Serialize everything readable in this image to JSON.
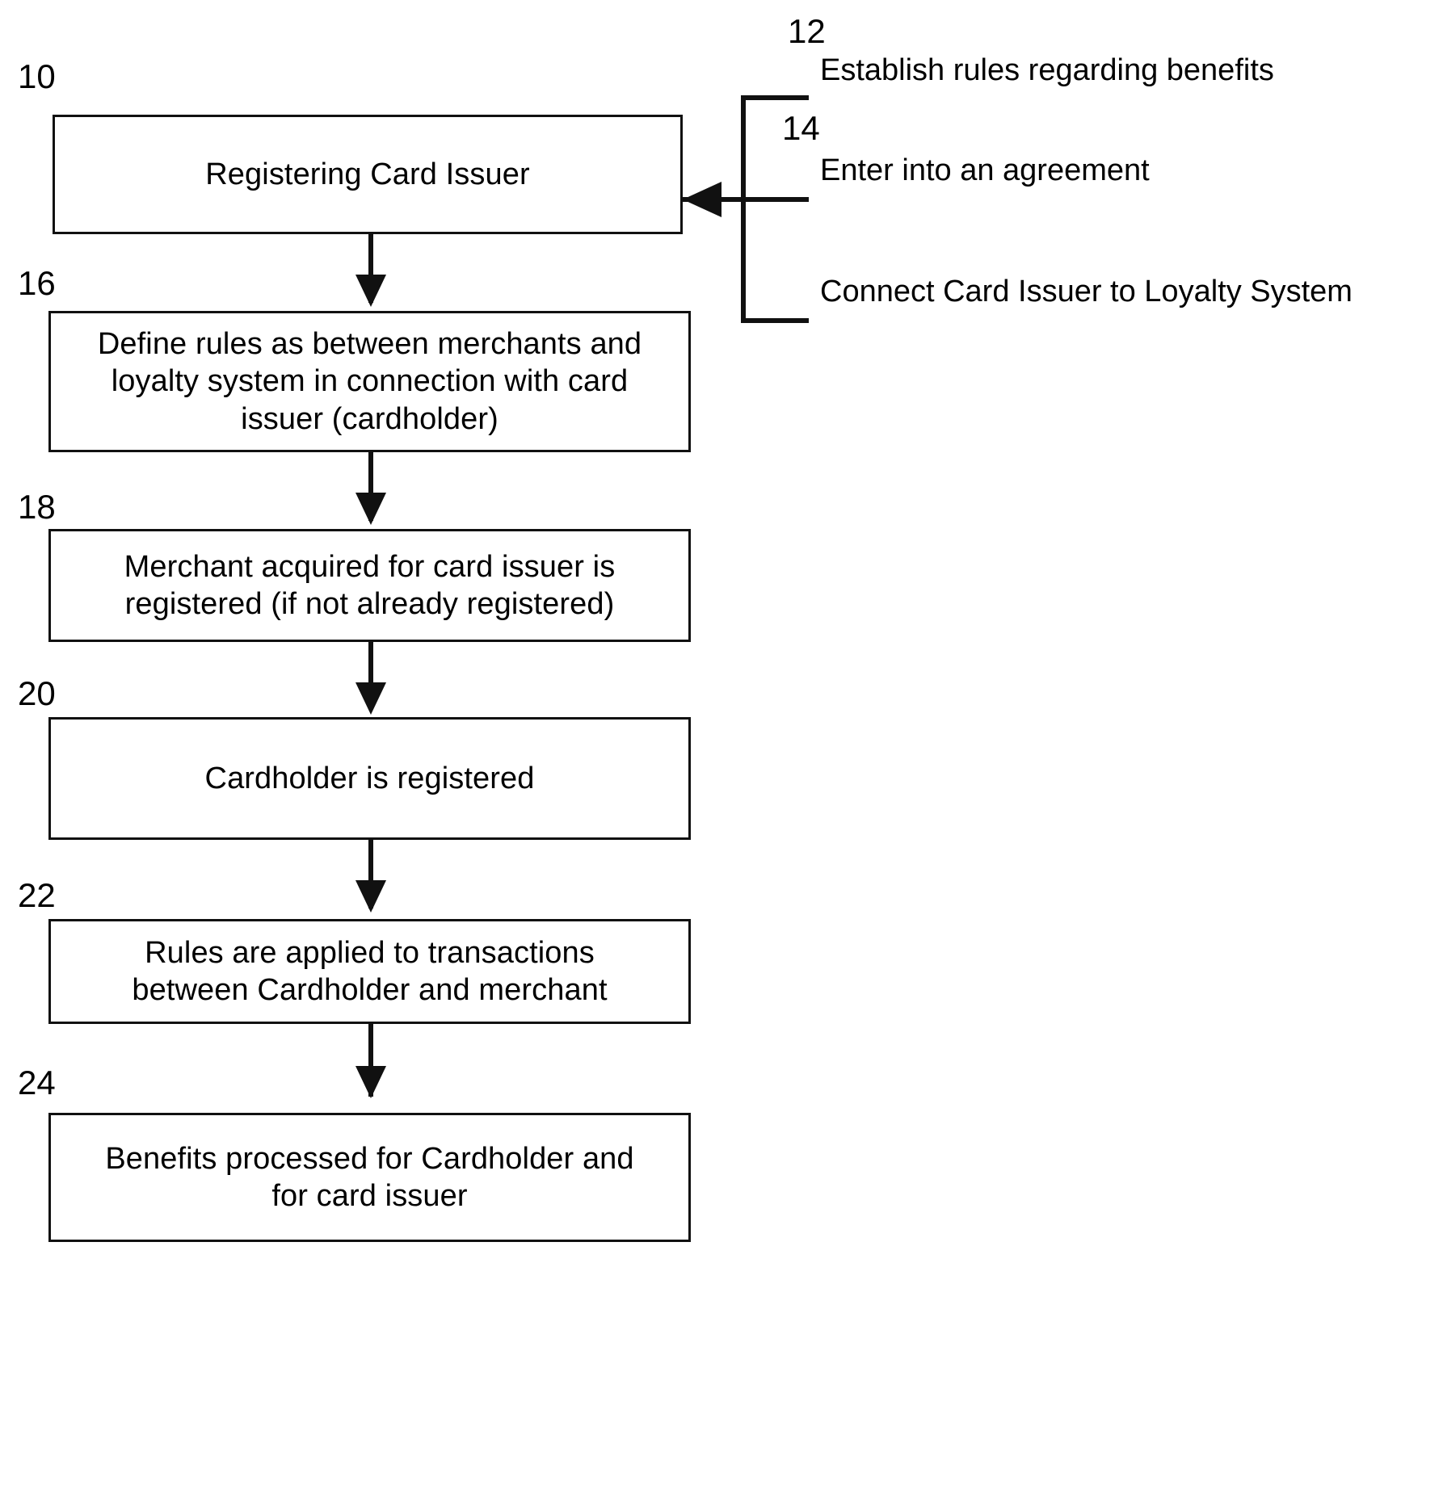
{
  "figure": {
    "type": "patent-flowchart",
    "background_color": "#ffffff",
    "line_color": "#111111"
  },
  "boxes": [
    {
      "ref": "10",
      "name": "registering-card-issuer",
      "text": "Registering Card Issuer"
    },
    {
      "ref": "16",
      "name": "define-rules",
      "text": "Define rules as between merchants and\nloyalty system in connection with card\nissuer (cardholder)"
    },
    {
      "ref": "18",
      "name": "merchant-registered",
      "text": "Merchant acquired for card issuer is\nregistered (if not already registered)"
    },
    {
      "ref": "20",
      "name": "cardholder-registered",
      "text": "Cardholder is registered"
    },
    {
      "ref": "22",
      "name": "rules-applied",
      "text": "Rules are applied to transactions\nbetween Cardholder and merchant"
    },
    {
      "ref": "24",
      "name": "benefits-processed",
      "text": "Benefits processed for Cardholder and\nfor card issuer"
    }
  ],
  "side_steps": [
    {
      "ref": "12",
      "name": "establish-rules",
      "text": "Establish rules regarding benefits"
    },
    {
      "ref": "14",
      "name": "enter-agreement",
      "text": "Enter into an agreement"
    },
    {
      "ref": null,
      "name": "connect-card-issuer",
      "text": "Connect Card Issuer to Loyalty System"
    }
  ]
}
